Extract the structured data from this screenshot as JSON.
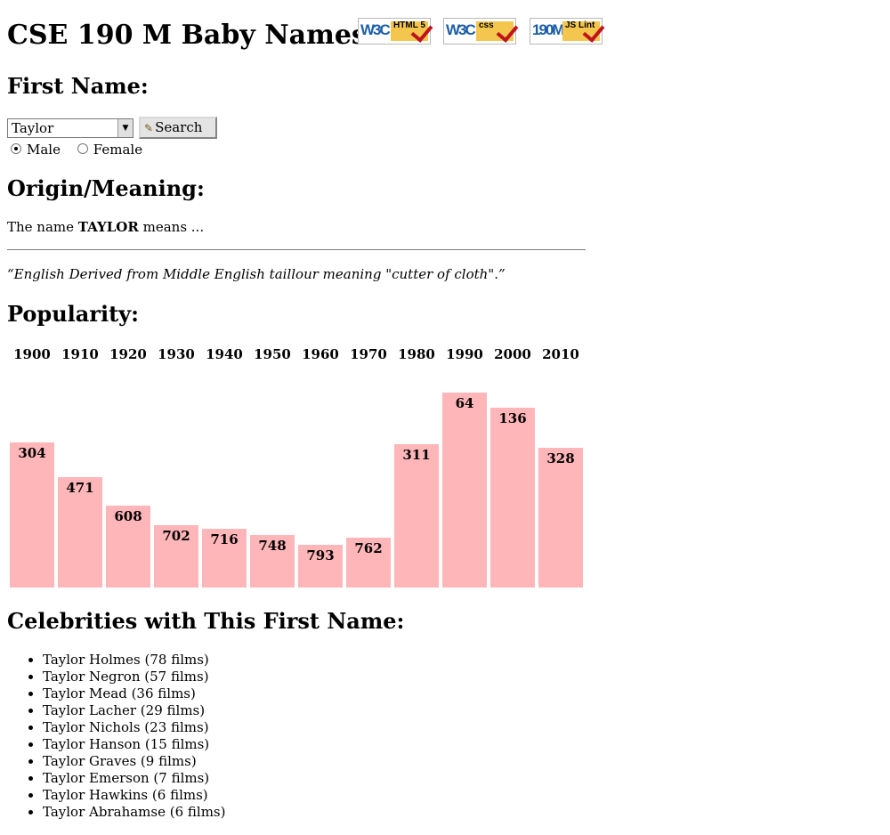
{
  "header": {
    "title": "CSE 190 M Baby Names",
    "badges": [
      {
        "left": "W3C",
        "right": "HTML 5",
        "icon": "check-icon"
      },
      {
        "left": "W3C",
        "right": "css",
        "icon": "check-icon"
      },
      {
        "left": "190M",
        "right": "JS Lint",
        "icon": "check-icon"
      }
    ]
  },
  "first_name": {
    "heading": "First Name:",
    "selected": "Taylor",
    "search_label": "Search",
    "gender_options": [
      {
        "label": "Male",
        "checked": true
      },
      {
        "label": "Female",
        "checked": false
      }
    ]
  },
  "meaning": {
    "heading": "Origin/Meaning:",
    "prefix": "The name",
    "name": "TAYLOR",
    "suffix": "means ...",
    "quote": "“English Derived from Middle English taillour meaning \"cutter of cloth\".”"
  },
  "popularity": {
    "heading": "Popularity:",
    "bar_color": "#ffb6b9"
  },
  "chart_data": {
    "type": "bar",
    "categories": [
      "1900",
      "1910",
      "1920",
      "1930",
      "1940",
      "1950",
      "1960",
      "1970",
      "1980",
      "1990",
      "2000",
      "2010"
    ],
    "values": [
      304,
      471,
      608,
      702,
      716,
      748,
      793,
      762,
      311,
      64,
      136,
      328
    ],
    "title": "",
    "xlabel": "",
    "ylabel": "",
    "note": "rank per decade; lower rank drawn as taller bar"
  },
  "celebrities": {
    "heading": "Celebrities with This First Name:",
    "items": [
      "Taylor Holmes (78 films)",
      "Taylor Negron (57 films)",
      "Taylor Mead (36 films)",
      "Taylor Lacher (29 films)",
      "Taylor Nichols (23 films)",
      "Taylor Hanson (15 films)",
      "Taylor Graves (9 films)",
      "Taylor Emerson (7 films)",
      "Taylor Hawkins (6 films)",
      "Taylor Abrahamse (6 films)"
    ]
  }
}
